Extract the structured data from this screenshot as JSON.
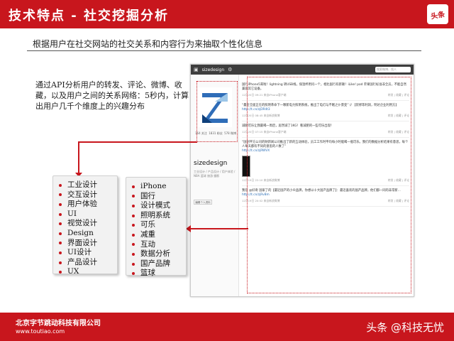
{
  "header": {
    "title": "技术特点 - 社交挖掘分析",
    "logo_text": "头条"
  },
  "subtitle": "根据用户在社交网站的社交关系和内容行为来抽取个性化信息",
  "description": "通过API分析用户的转发、评论、微博、收藏，以及用户之间的关系网络：5秒内，计算出用户几千个维度上的兴趣分布",
  "left_list": [
    "工业设计",
    "交互设计",
    "用户体验",
    "UI",
    "视觉设计",
    "Design",
    "界面设计",
    "UI设计",
    "产品设计",
    "UX"
  ],
  "right_list": [
    "iPhone",
    "国行",
    "设计模式",
    "照明系统",
    "可乐",
    "减重",
    "互动",
    "数据分析",
    "国产品牌",
    "篮球"
  ],
  "screenshot": {
    "brand": "sizedesign",
    "search_placeholder": "搜索微博、找人",
    "username": "sizedesign",
    "stats": [
      "164 关注",
      "1831 粉丝",
      "578 微博"
    ],
    "meta": "工业设计 / 产品设计 / 用户体验 / NBA 篮球 旅游 摄影",
    "left_button": "编辑个人资料",
    "posts": [
      {
        "text": "国行iPhone5来啦！lightning 转USB线，保温杯用问一个，相比国行有新颖！iLike! pod 苹果国行标准非全员，不能自然兼容其它设备。",
        "time": "12月20日 09:21 来自iPhone客户端",
        "link": ""
      },
      {
        "text": "“最近全面正在的照明革命下一颗新电力照明系统，推出了电灯与不眠之仆景变” // 【装修等利润，明达企业利用方】",
        "time": "12月20日 08:45 来自新浪微博",
        "link": "http://t.cn/zjDR4t3"
      },
      {
        "text": "减肥可乐让我最喝一周后，居然减了1KG！看减肥的一些可乐出现！",
        "time": "12月20日 07:15 来自iPhone客户端",
        "link": ""
      },
      {
        "text": "“国创平方公司的财新闻公司推出了新的互动体验，员工工作时平均每小时能喝一瓶可乐。我们的数据分析结果有意思，每个人每天都有不同的意思的人数了”",
        "time": "12月19日 22:10 来自新浪微博",
        "link": "http://t.cn/zjRWVX"
      },
      {
        "text": "我在 @好奇 国家了的【最近国产的小众品牌，你想以十大国产品牌了】：最近喜欢的国产品牌，他们都一同的非常新...",
        "time": "12月19日 20:02 来自新浪微博",
        "link": "http://t.cn/zjRv8m"
      }
    ]
  },
  "footer": {
    "company": "北京字节跳动科技有限公司",
    "url": "www.toutiao.com",
    "watermark": "头条 @科技无忧"
  },
  "colors": {
    "accent": "#c8161d"
  }
}
